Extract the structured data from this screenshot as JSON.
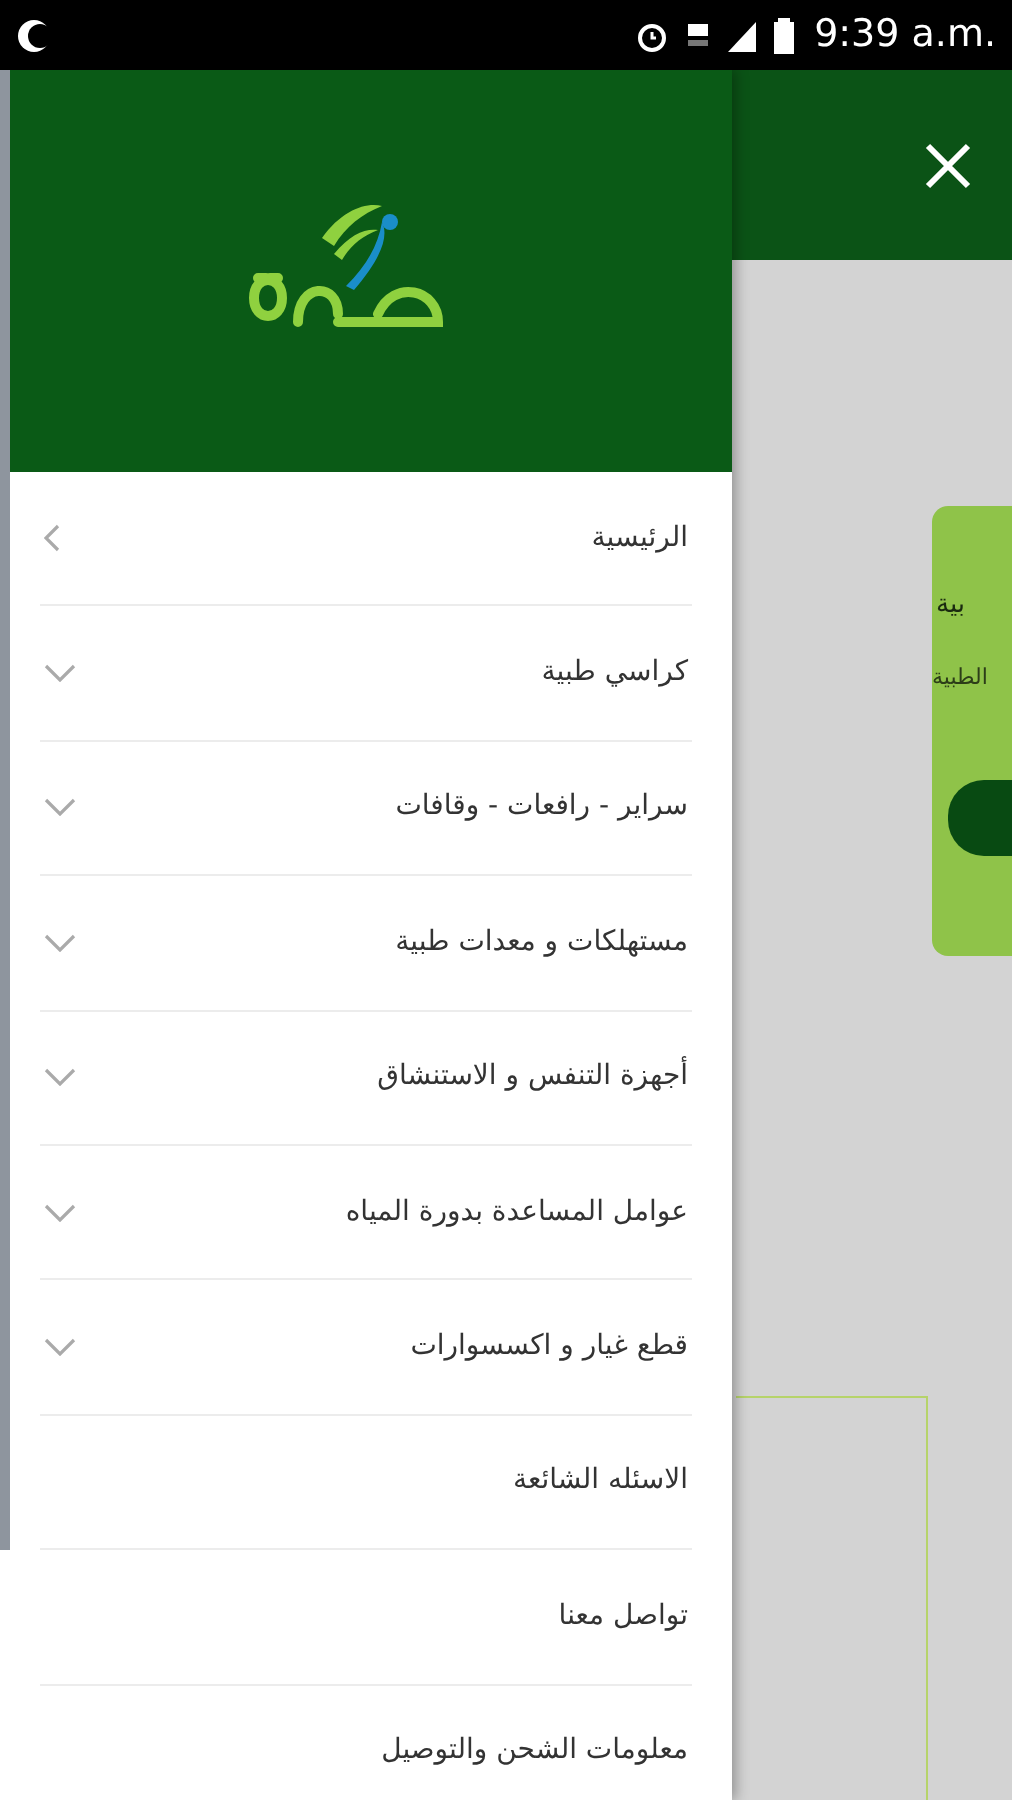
{
  "status_bar": {
    "time": "9:39 a.m."
  },
  "drawer": {
    "items": [
      {
        "label": "الرئيسية",
        "kind": "link"
      },
      {
        "label": "كراسي طبية",
        "kind": "group"
      },
      {
        "label": "سراير - رافعات - وقافات",
        "kind": "group"
      },
      {
        "label": "مستهلكات و معدات طبية",
        "kind": "group"
      },
      {
        "label": "أجهزة التنفس و الاستنشاق",
        "kind": "group"
      },
      {
        "label": "عوامل المساعدة بدورة المياه",
        "kind": "group"
      },
      {
        "label": "قطع غيار و اكسسوارات",
        "kind": "group"
      },
      {
        "label": "الاسئله الشائعة",
        "kind": "plain"
      },
      {
        "label": "تواصل معنا",
        "kind": "plain"
      },
      {
        "label": "معلومات الشحن والتوصيل",
        "kind": "plain"
      }
    ]
  },
  "background_page": {
    "card_title": "بية",
    "card_text": "الطبية"
  }
}
